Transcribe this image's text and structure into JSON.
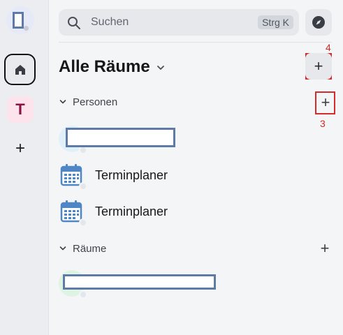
{
  "rail": {
    "space_letter": "T",
    "add_label": "+"
  },
  "search": {
    "placeholder": "Suchen",
    "shortcut": "Strg K"
  },
  "header": {
    "title": "Alle Räume",
    "add_label": "+"
  },
  "annotations": {
    "add_room": "4",
    "add_person": "3"
  },
  "sections": {
    "people": {
      "label": "Personen",
      "add_label": "+",
      "items": [
        {
          "label": "Terminplaner"
        },
        {
          "label": "Terminplaner"
        }
      ]
    },
    "rooms": {
      "label": "Räume",
      "add_label": "+"
    }
  },
  "colors": {
    "accent": "#0b7a75",
    "space_bg": "#fde3ec",
    "space_text": "#8c1245",
    "annotation_red": "#d62b2b",
    "calendar_blue": "#4f86c6"
  }
}
